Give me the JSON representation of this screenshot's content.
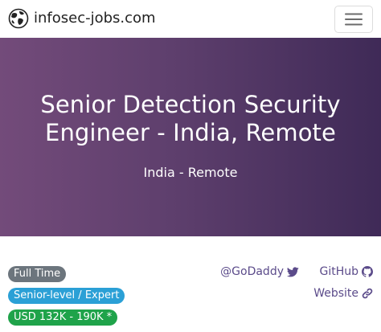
{
  "navbar": {
    "brand": "infosec-jobs.com",
    "logo_icon": "globe-logo-icon",
    "menu_icon": "hamburger-menu-icon"
  },
  "hero": {
    "title": "Senior Detection Security Engineer - India, Remote",
    "location": "India - Remote"
  },
  "badges": {
    "employment_type": "Full Time",
    "level": "Senior-level / Expert",
    "salary": "USD 132K - 190K *"
  },
  "links": {
    "company": "@GoDaddy",
    "github": "GitHub",
    "website": "Website"
  },
  "colors": {
    "hero_start": "#734b7a",
    "hero_end": "#3f2a57",
    "badge_type": "#6c757d",
    "badge_level": "#2ba0d6",
    "badge_salary": "#1fa34a",
    "link": "#5b4b8a"
  }
}
